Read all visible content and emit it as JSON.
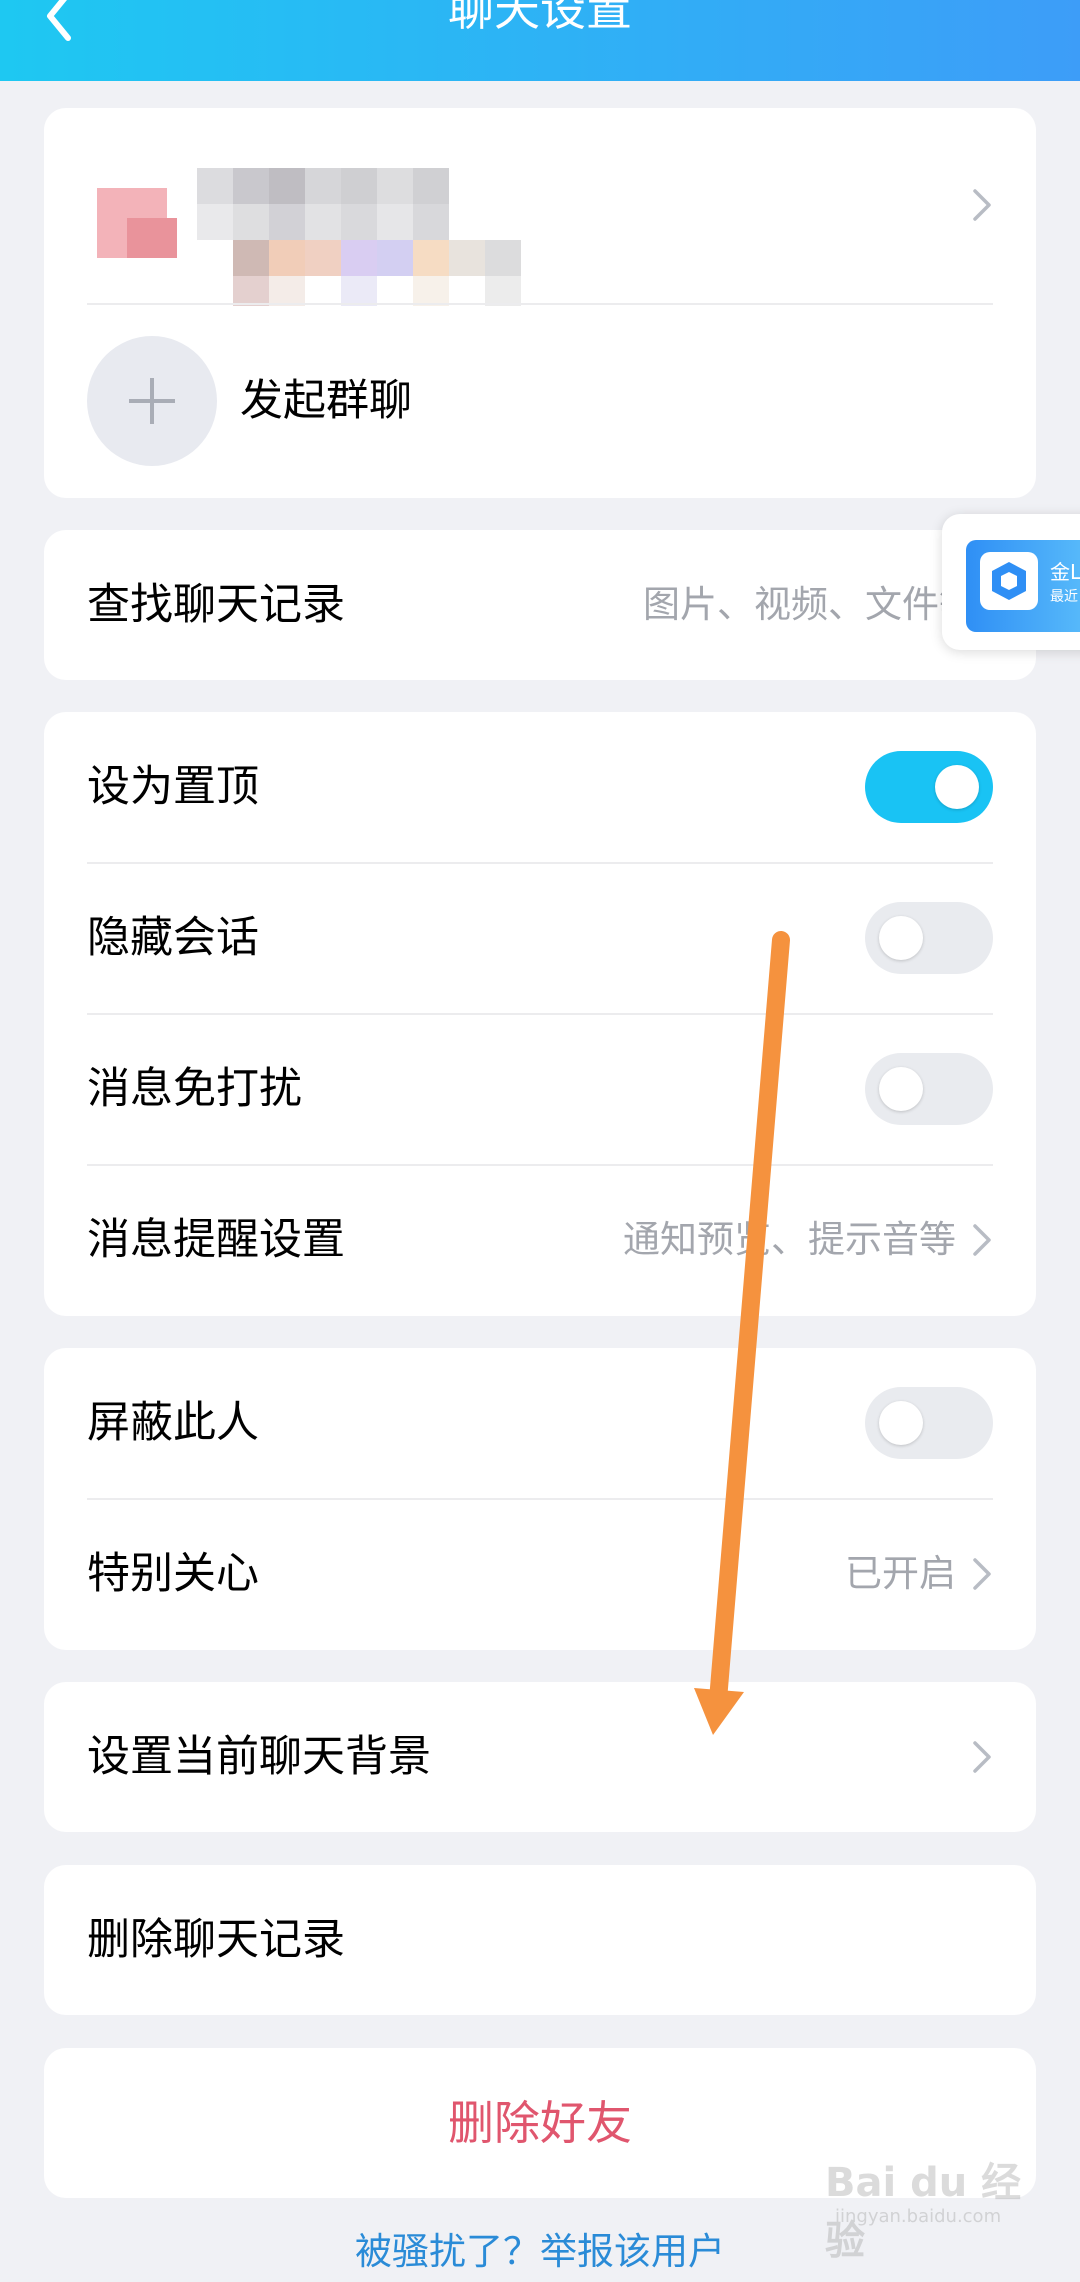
{
  "header": {
    "title": "聊天设置"
  },
  "profile": {
    "start_group_label": "发起群聊"
  },
  "search_history": {
    "label": "查找聊天记录",
    "hint": "图片、视频、文件等"
  },
  "settings": {
    "pin": {
      "label": "设为置顶",
      "on": true
    },
    "hide": {
      "label": "隐藏会话",
      "on": false
    },
    "mute": {
      "label": "消息免打扰",
      "on": false
    },
    "notify": {
      "label": "消息提醒设置",
      "hint": "通知预览、提示音等"
    }
  },
  "privacy": {
    "block": {
      "label": "屏蔽此人",
      "on": false
    },
    "special": {
      "label": "特别关心",
      "hint": "已开启"
    }
  },
  "background": {
    "label": "设置当前聊天背景"
  },
  "clear_history": {
    "label": "删除聊天记录"
  },
  "delete_friend": {
    "label": "删除好友"
  },
  "report_link": "被骚扰了？举报该用户",
  "floating_widget": {
    "title": "金L",
    "subtitle": "最近"
  },
  "watermark": {
    "brand": "Bai du 经验",
    "url": "jingyan.baidu.com"
  },
  "colors": {
    "accent": "#19c3f4",
    "danger": "#e0566e",
    "link": "#2a8bd7",
    "annotation": "#f5923e"
  }
}
